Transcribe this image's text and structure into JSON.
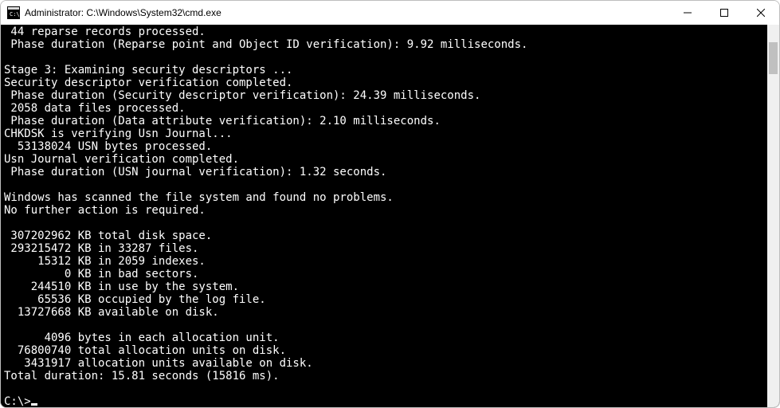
{
  "window": {
    "title": "Administrator: C:\\Windows\\System32\\cmd.exe"
  },
  "console": {
    "lines": [
      " 44 reparse records processed.",
      " Phase duration (Reparse point and Object ID verification): 9.92 milliseconds.",
      "",
      "Stage 3: Examining security descriptors ...",
      "Security descriptor verification completed.",
      " Phase duration (Security descriptor verification): 24.39 milliseconds.",
      " 2058 data files processed.",
      " Phase duration (Data attribute verification): 2.10 milliseconds.",
      "CHKDSK is verifying Usn Journal...",
      "  53138024 USN bytes processed.",
      "Usn Journal verification completed.",
      " Phase duration (USN journal verification): 1.32 seconds.",
      "",
      "Windows has scanned the file system and found no problems.",
      "No further action is required.",
      "",
      " 307202962 KB total disk space.",
      " 293215472 KB in 33287 files.",
      "     15312 KB in 2059 indexes.",
      "         0 KB in bad sectors.",
      "    244510 KB in use by the system.",
      "     65536 KB occupied by the log file.",
      "  13727668 KB available on disk.",
      "",
      "      4096 bytes in each allocation unit.",
      "  76800740 total allocation units on disk.",
      "   3431917 allocation units available on disk.",
      "Total duration: 15.81 seconds (15816 ms).",
      ""
    ],
    "prompt": "C:\\>"
  }
}
